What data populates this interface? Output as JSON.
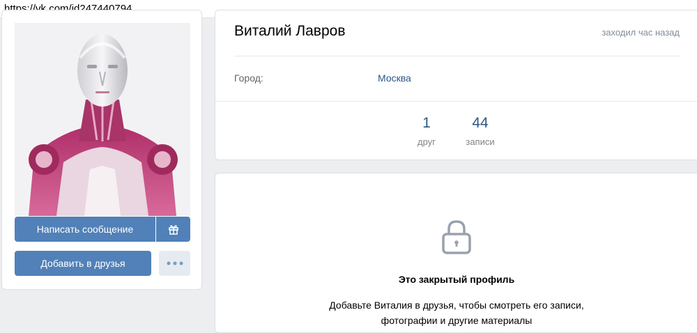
{
  "browser": {
    "url": "https://vk.com/id247440794"
  },
  "profile": {
    "name": "Виталий Лавров",
    "last_seen": "заходил час назад",
    "city_label": "Город:",
    "city_value": "Москва"
  },
  "counters": {
    "friends_value": "1",
    "friends_label": "друг",
    "posts_value": "44",
    "posts_label": "записи"
  },
  "actions": {
    "message_label": "Написать сообщение",
    "add_friend_label": "Добавить в друзья",
    "gift_icon": "gift-icon",
    "more_icon": "more-dots-icon"
  },
  "closed_profile": {
    "title": "Это закрытый профиль",
    "line1": "Добавьте Виталия в друзья, чтобы смотреть его записи,",
    "line2": "фотографии и другие материалы",
    "icon": "lock-icon"
  },
  "colors": {
    "accent": "#5181b8",
    "link": "#2a5885",
    "page_bg": "#edeef0",
    "muted": "#818c99"
  }
}
